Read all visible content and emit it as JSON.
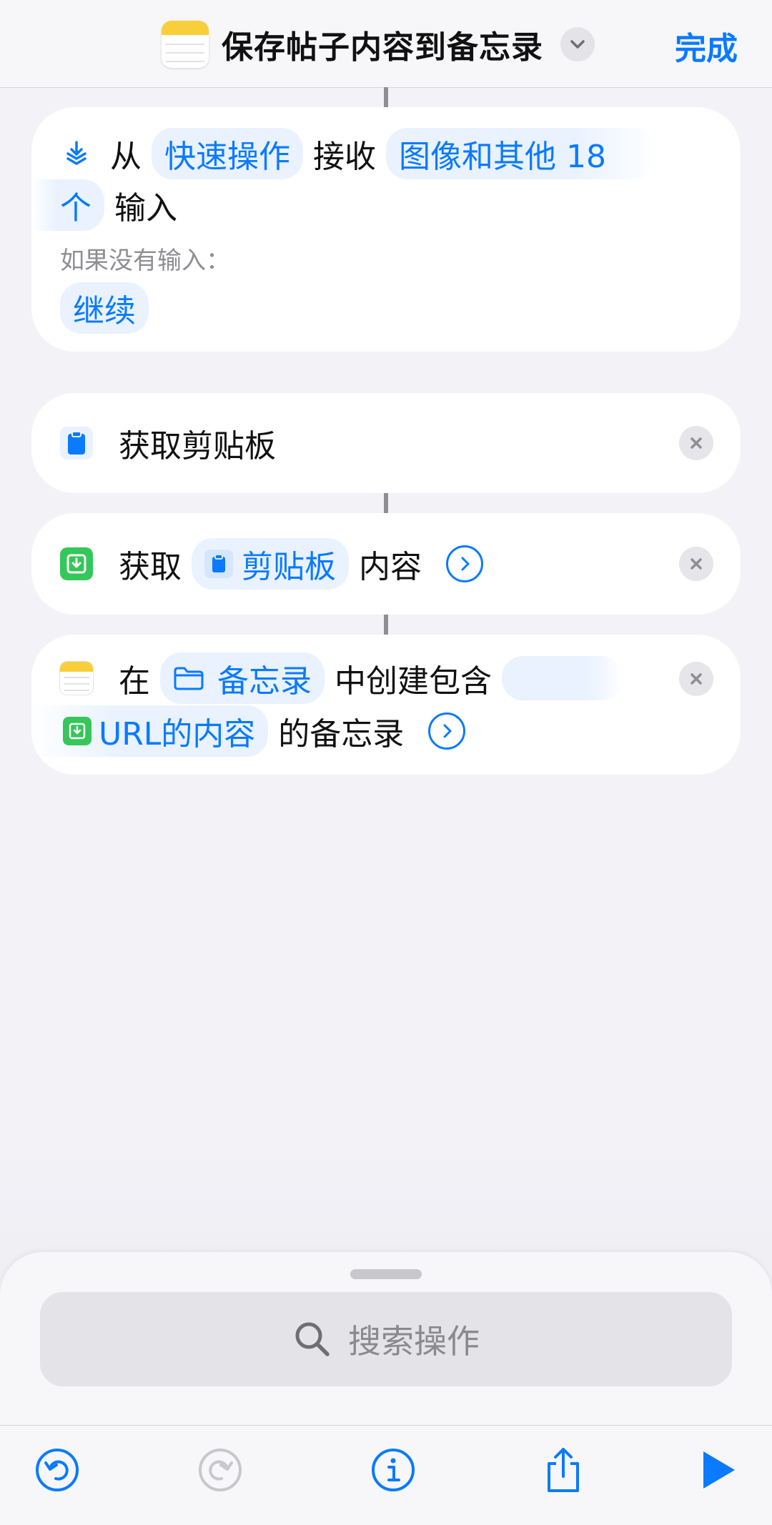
{
  "header": {
    "title": "保存帖子内容到备忘录",
    "done_label": "完成"
  },
  "receive_action": {
    "from_label": "从",
    "source_token": "快速操作",
    "receive_label": "接收",
    "input_token_line1": "图像和其他 18",
    "input_token_line2": "个",
    "input_label": "输入",
    "if_no_input_label": "如果没有输入：",
    "fallback_token": "继续"
  },
  "clipboard_action": {
    "label": "获取剪贴板"
  },
  "get_contents_action": {
    "get_label": "获取",
    "clipboard_token": "剪贴板",
    "contents_label": "内容"
  },
  "create_note_action": {
    "in_label": "在",
    "folder_token": "备忘录",
    "create_label": "中创建包含",
    "content_token": "URL的内容",
    "note_label": "的备忘录"
  },
  "search": {
    "placeholder": "搜索操作"
  },
  "colors": {
    "accent": "#0a7aff",
    "token_bg": "#e9f2fe",
    "green_icon": "#34c759",
    "notes_yellow": "#f8cf3a"
  },
  "icons": {
    "header": [
      "notes-app-icon",
      "chevron-down-icon"
    ],
    "actions": [
      "receive-input-icon",
      "clipboard-icon",
      "get-contents-icon",
      "notes-icon",
      "folder-icon"
    ],
    "toolbar": [
      "undo-icon",
      "redo-icon",
      "info-icon",
      "share-icon",
      "play-icon"
    ]
  }
}
